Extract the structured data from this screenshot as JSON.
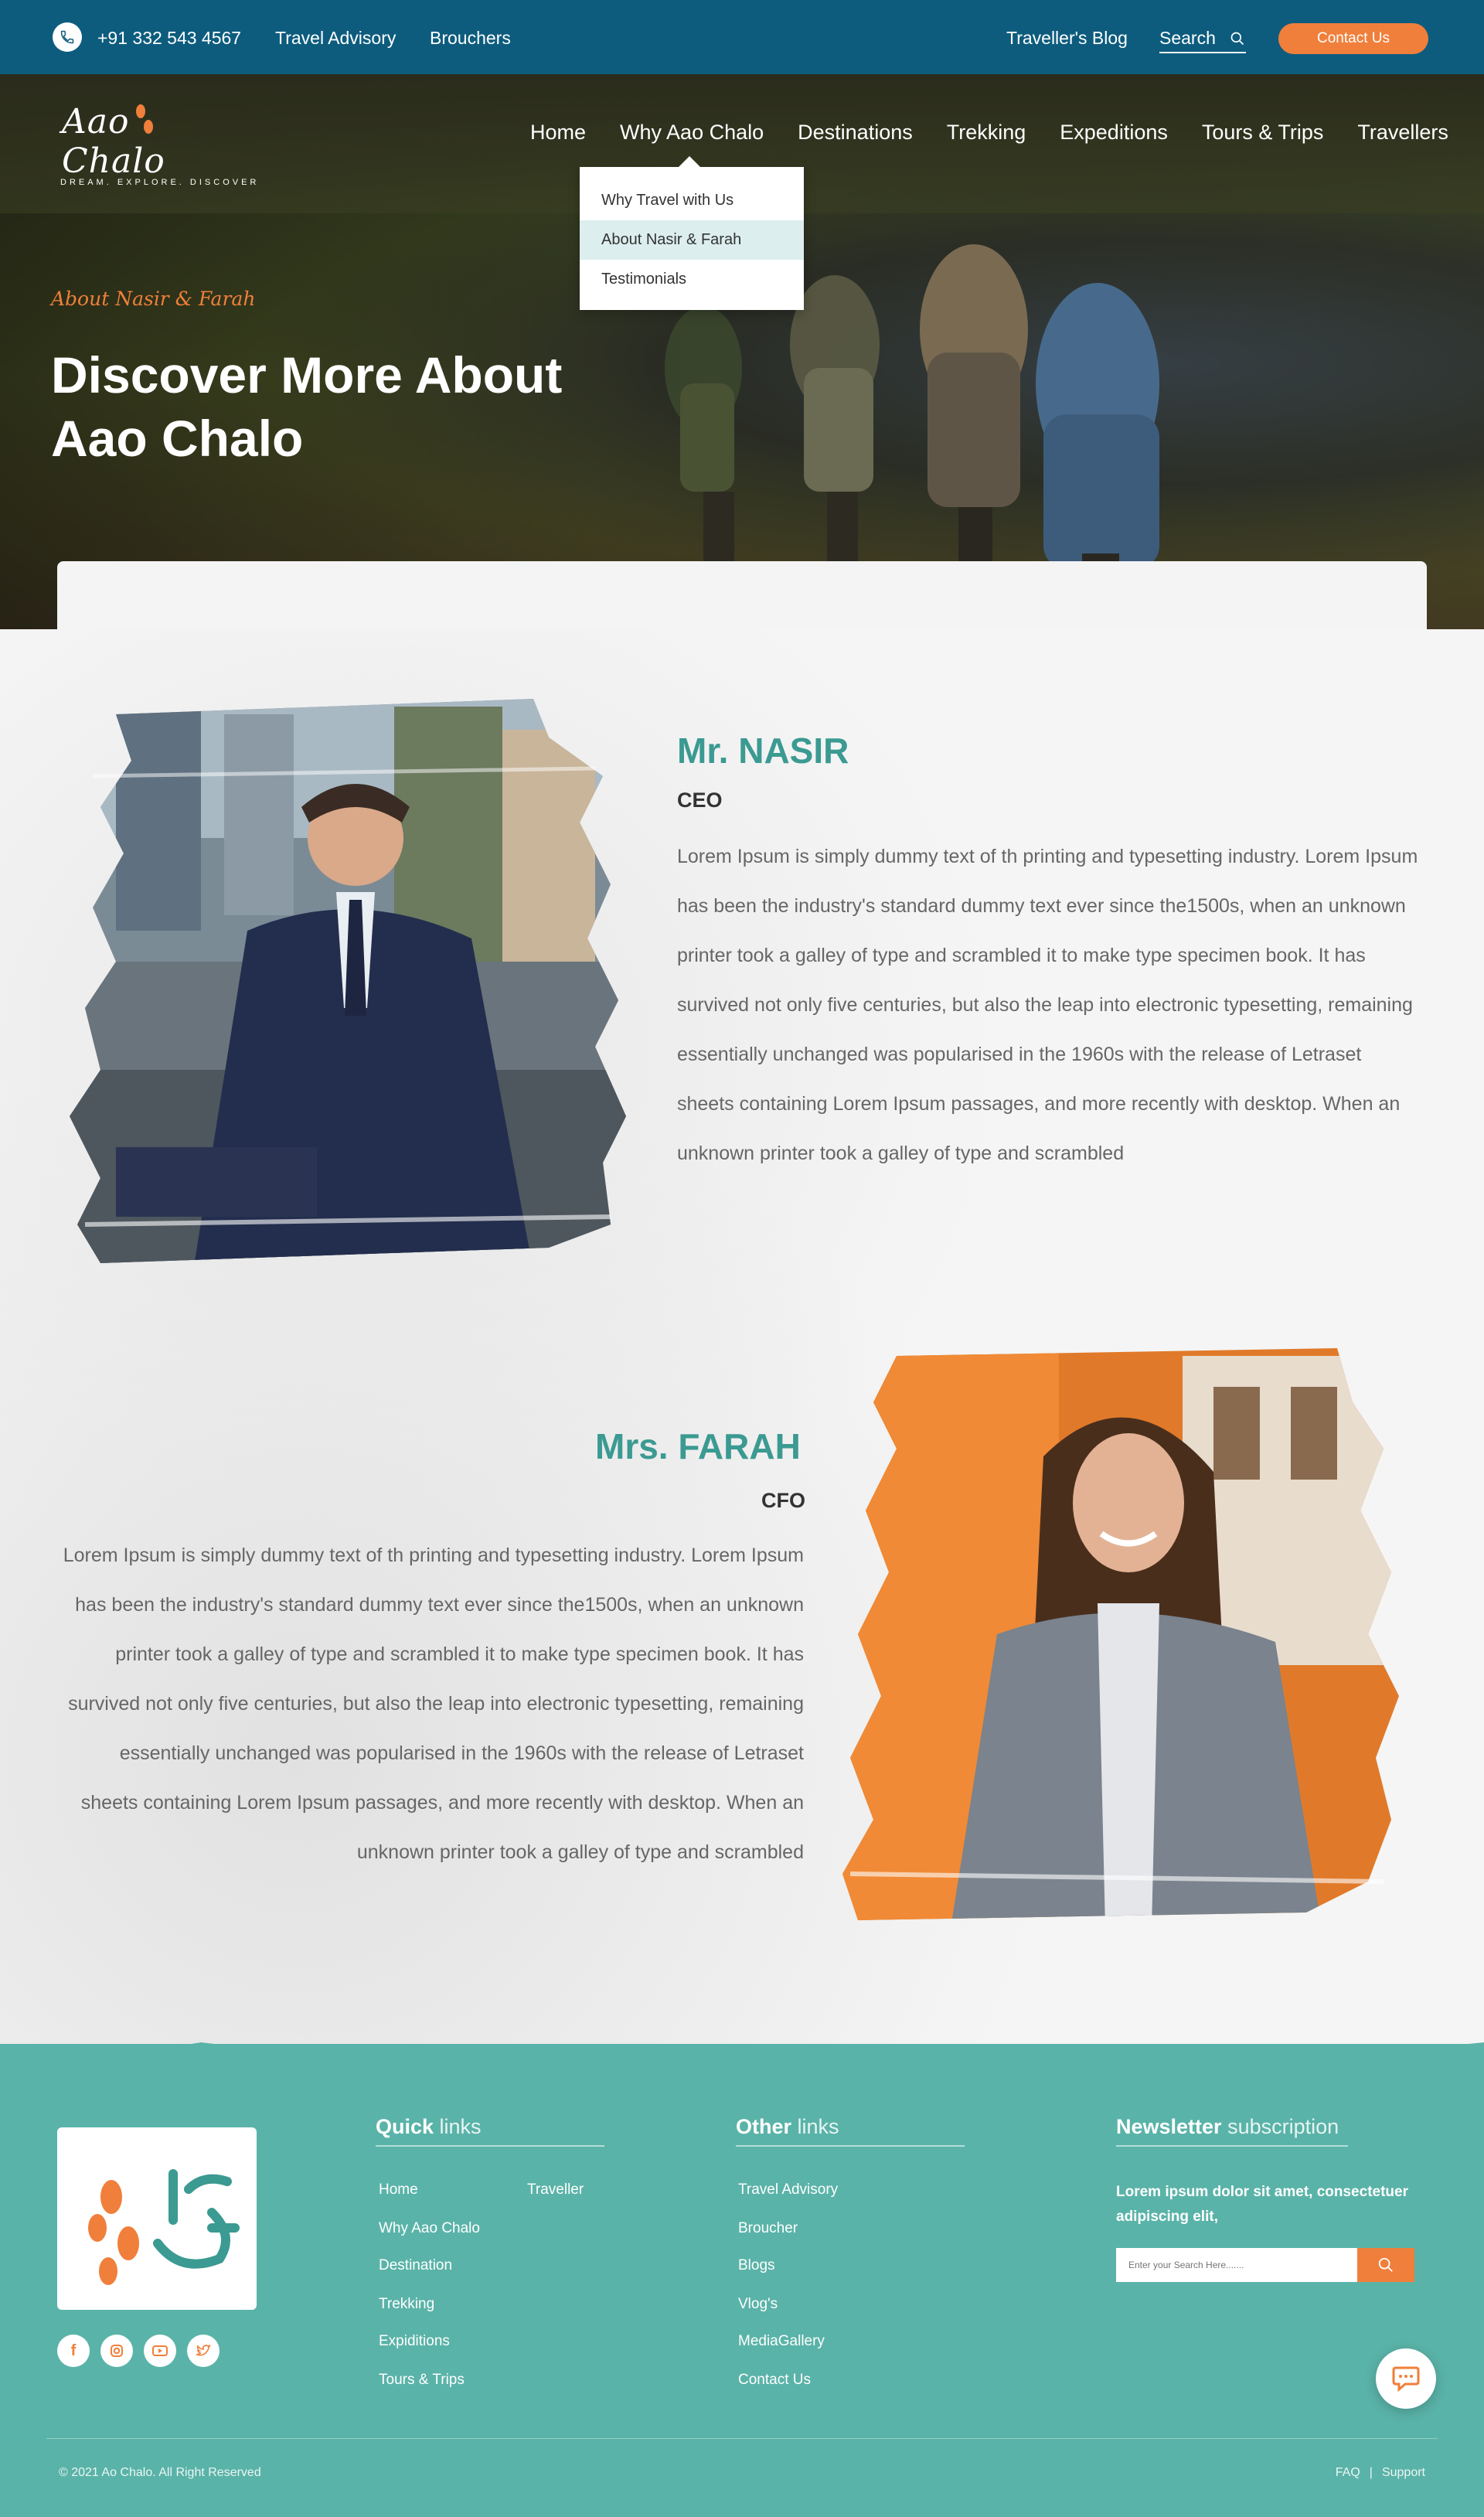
{
  "topbar": {
    "phone": "+91 332 543 4567",
    "links": [
      "Travel Advisory",
      "Brouchers"
    ],
    "blog": "Traveller's Blog",
    "search_label": "Search",
    "contact_button": "Contact Us"
  },
  "logo": {
    "name": "Aao Chalo",
    "tagline": "DREAM. EXPLORE. DISCOVER"
  },
  "nav": {
    "items": [
      "Home",
      "Why Aao Chalo",
      "Destinations",
      "Trekking",
      "Expeditions",
      "Tours & Trips",
      "Travellers"
    ],
    "dropdown": [
      "Why Travel with Us",
      "About Nasir & Farah",
      "Testimonials"
    ],
    "dropdown_active": "About Nasir & Farah"
  },
  "hero": {
    "kicker": "About Nasir & Farah",
    "headline": "Discover More About Aao Chalo"
  },
  "people": [
    {
      "name": "Mr. NASIR",
      "role": "CEO",
      "bio": "Lorem Ipsum is simply  dummy  text   of  th  printing  and  typesetting industry. Lorem Ipsum has been the industry's standard dummy text ever since the1500s, when an unknown printer took  a  galley of type and scrambled it  to make  type specimen  book. It has  survived not only  five centuries, but also   the  leap into electronic typesetting, remaining essentially unchanged was popularised  in the 1960s with the release of Letraset sheets containing Lorem Ipsum  passages, and more recently with desktop. When  an  unknown printer took  a  galley  of type  and  scrambled"
    },
    {
      "name": "Mrs. FARAH",
      "role": "CFO",
      "bio": "Lorem Ipsum is simply  dummy  text   of  th  printing  and  typesetting industry. Lorem Ipsum has been the industry's standard dummy text ever since the1500s, when an unknown printer took  a  galley of type and scrambled it  to make  type specimen  book. It has  survived not only  five centuries, but also   the  leap into electronic typesetting, remaining essentially unchanged was popularised  in the 1960s with the release of Letraset sheets containing Lorem Ipsum  passages, and more recently with desktop. When  an  unknown printer took  a  galley  of type  and  scrambled"
    }
  ],
  "footer": {
    "quick_title_bold": "Quick",
    "quick_title_light": "links",
    "quick_links_col1": [
      "Home",
      "Why Aao Chalo",
      "Destination",
      "Trekking",
      "Expiditions",
      "Tours & Trips"
    ],
    "quick_links_col2": [
      "Traveller"
    ],
    "other_title_bold": "Other",
    "other_title_light": "links",
    "other_links": [
      "Travel Advisory",
      "Broucher",
      "Blogs",
      "Vlog's",
      "MediaGallery",
      "Contact Us"
    ],
    "news_title_bold": "Newsletter",
    "news_title_light": "subscription",
    "news_text": "Lorem ipsum dolor sit amet, consectetuer adipiscing elit,",
    "news_placeholder": "Enter your Search Here.......",
    "copyright": "© 2021 Ao Chalo. All Right Reserved",
    "bottom_links": [
      "FAQ",
      "|",
      "Support"
    ],
    "socials": [
      "facebook-icon",
      "instagram-icon",
      "youtube-icon",
      "twitter-icon"
    ]
  },
  "colors": {
    "topbar": "#0d5c7e",
    "accent": "#f07f3b",
    "teal": "#3b9a92",
    "footer": "#5ab3a8"
  }
}
